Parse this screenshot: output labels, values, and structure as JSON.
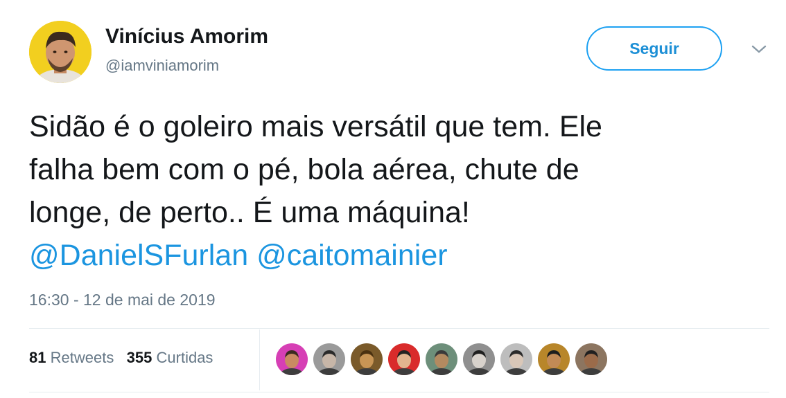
{
  "author": {
    "name": "Vinícius Amorim",
    "handle": "@iamviniamorim"
  },
  "follow_button": {
    "label": "Seguir"
  },
  "menu": {
    "icon": "chevron-down-icon"
  },
  "tweet": {
    "line1": "Sidão é o goleiro mais versátil que tem. Ele",
    "line2": "falha bem com o pé, bola aérea, chute de",
    "line3": "longe, de perto.. É uma máquina!",
    "mention1": "@DanielSFurlan",
    "mention2": "@caitomainier"
  },
  "timestamp": "16:30 - 12 de mai de 2019",
  "stats": {
    "retweets_count": "81",
    "retweets_label": "Retweets",
    "likes_count": "355",
    "likes_label": "Curtidas"
  },
  "colors": {
    "accent": "#1da1f2",
    "mention": "#1b95e0",
    "secondary_text": "#657786"
  },
  "likers": [
    {
      "bg": "#d63fb5",
      "skin": "#c98a62",
      "hair": "#3a2a20"
    },
    {
      "bg": "#9a9a9a",
      "skin": "#c7b6a8",
      "hair": "#2a2a2a"
    },
    {
      "bg": "#7a5a2a",
      "skin": "#c89555",
      "hair": "#4a3110"
    },
    {
      "bg": "#d92b2b",
      "skin": "#e1b48f",
      "hair": "#222222"
    },
    {
      "bg": "#6d8f7a",
      "skin": "#b38a60",
      "hair": "#3a3a3a"
    },
    {
      "bg": "#8f8f8f",
      "skin": "#d8d2cc",
      "hair": "#1f1f1f"
    },
    {
      "bg": "#bdbdbd",
      "skin": "#d9c7b8",
      "hair": "#2b2b2b"
    },
    {
      "bg": "#b8862a",
      "skin": "#c28a56",
      "hair": "#1d1d1d"
    },
    {
      "bg": "#8c7560",
      "skin": "#9b6b4a",
      "hair": "#202020"
    }
  ]
}
